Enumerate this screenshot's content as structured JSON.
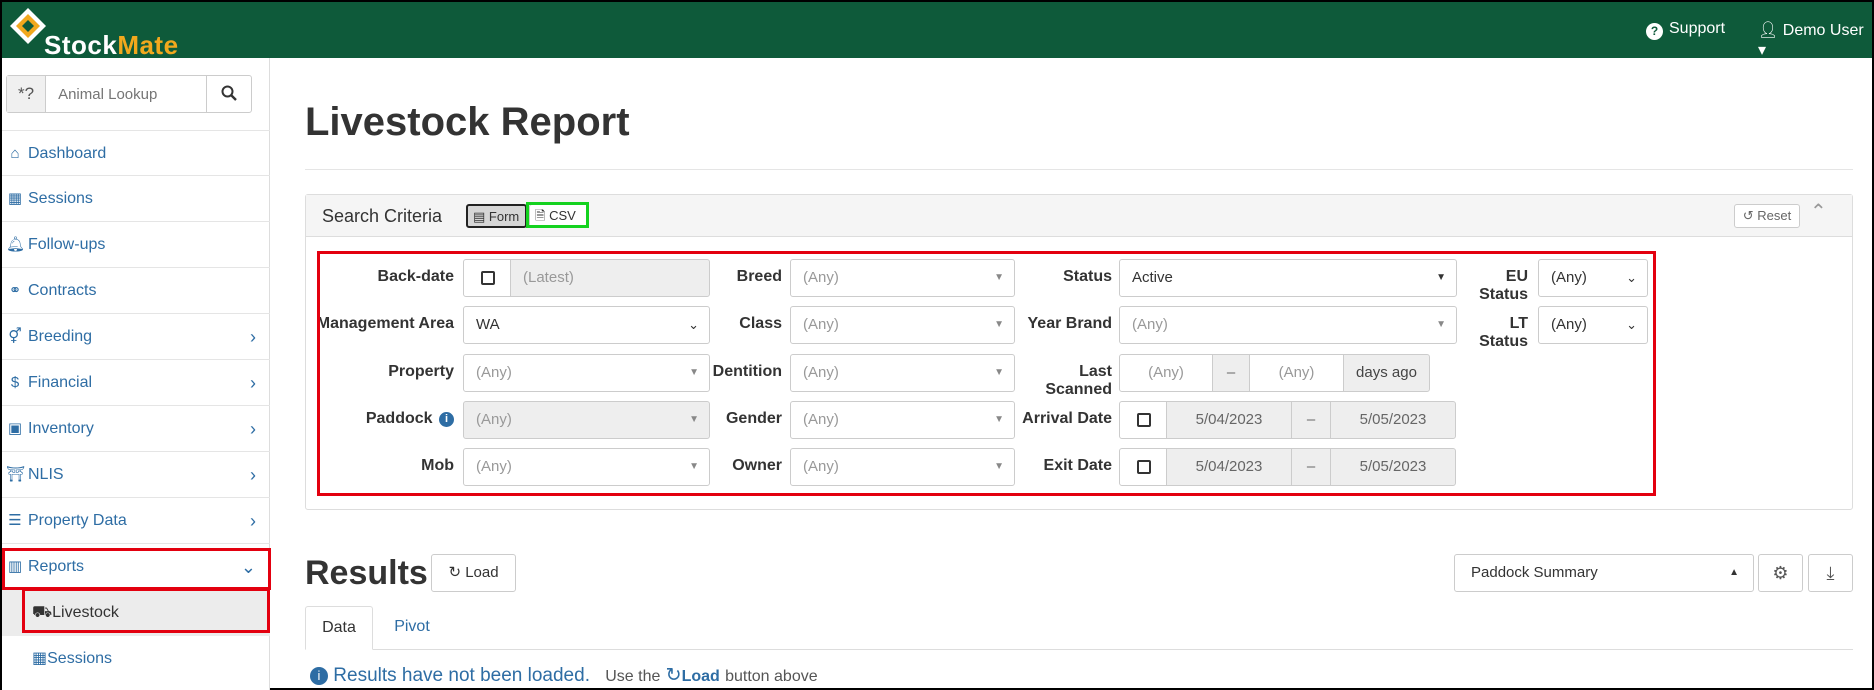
{
  "app": {
    "name_part1": "Stock",
    "name_part2": "Mate"
  },
  "topbar": {
    "support": "Support",
    "user": "Demo User"
  },
  "sidebar": {
    "lookup_prefix": "*?",
    "lookup_placeholder": "Animal Lookup",
    "items": [
      {
        "label": "Dashboard",
        "icon": "home-icon"
      },
      {
        "label": "Sessions",
        "icon": "table-icon"
      },
      {
        "label": "Follow-ups",
        "icon": "bell-icon"
      },
      {
        "label": "Contracts",
        "icon": "handshake-icon"
      },
      {
        "label": "Breeding",
        "icon": "venus-mars-icon"
      },
      {
        "label": "Financial",
        "icon": "dollar-icon"
      },
      {
        "label": "Inventory",
        "icon": "boxes-icon"
      },
      {
        "label": "NLIS",
        "icon": "bank-icon"
      },
      {
        "label": "Property Data",
        "icon": "sliders-icon"
      },
      {
        "label": "Reports",
        "icon": "bar-chart-icon"
      }
    ],
    "subitems": [
      {
        "label": "Livestock",
        "icon": "truck-icon"
      },
      {
        "label": "Sessions",
        "icon": "table-icon"
      }
    ]
  },
  "page": {
    "title": "Livestock Report"
  },
  "search": {
    "title": "Search Criteria",
    "mode_form": "Form",
    "mode_csv": "CSV",
    "reset": "Reset",
    "labels": {
      "backdate": "Back-date",
      "management_area": "Management Area",
      "property": "Property",
      "paddock": "Paddock",
      "mob": "Mob",
      "breed": "Breed",
      "class": "Class",
      "dentition": "Dentition",
      "gender": "Gender",
      "owner": "Owner",
      "status": "Status",
      "year_brand": "Year Brand",
      "last_scanned": "Last Scanned",
      "arrival_date": "Arrival Date",
      "exit_date": "Exit Date",
      "eu_status": "EU Status",
      "lt_status": "LT Status"
    },
    "values": {
      "backdate": "(Latest)",
      "management_area": "WA",
      "property": "(Any)",
      "paddock": "(Any)",
      "mob": "(Any)",
      "breed": "(Any)",
      "class": "(Any)",
      "dentition": "(Any)",
      "gender": "(Any)",
      "owner": "(Any)",
      "status": "Active",
      "year_brand": "(Any)",
      "last_scanned_from": "(Any)",
      "range_sep": "–",
      "last_scanned_to": "(Any)",
      "last_scanned_unit": "days ago",
      "arrival_from": "5/04/2023",
      "arrival_to": "5/05/2023",
      "exit_from": "5/04/2023",
      "exit_to": "5/05/2023",
      "eu_status": "(Any)",
      "lt_status": "(Any)"
    }
  },
  "results": {
    "title": "Results",
    "load": "Load",
    "summary": "Paddock Summary",
    "tab_data": "Data",
    "tab_pivot": "Pivot",
    "notice": "Results have not been loaded.",
    "notice_use": "Use the",
    "notice_load": "Load",
    "notice_tail": "button above"
  }
}
